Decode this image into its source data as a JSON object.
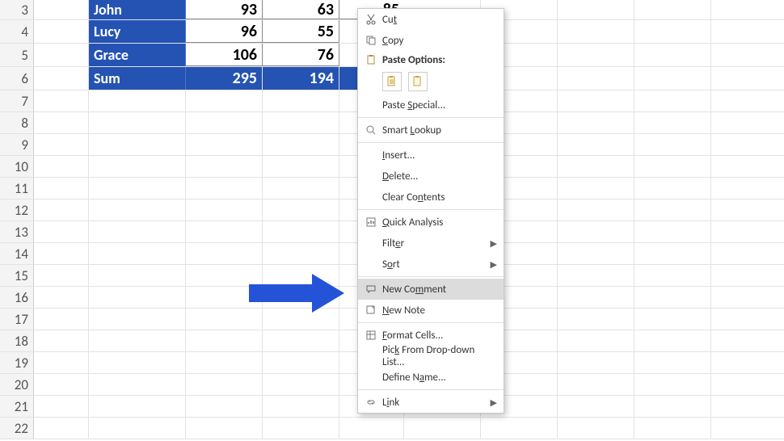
{
  "rows": [
    "3",
    "4",
    "5",
    "6",
    "7",
    "8",
    "9",
    "10",
    "11",
    "12",
    "13",
    "14",
    "15",
    "16",
    "17",
    "18",
    "19",
    "20",
    "21",
    "22"
  ],
  "table": {
    "r3": {
      "name": "John",
      "a": "93",
      "b": "63",
      "c": "85"
    },
    "r4": {
      "name": "Lucy",
      "a": "96",
      "b": "55"
    },
    "r5": {
      "name": "Grace",
      "a": "106",
      "b": "76"
    },
    "r6": {
      "name": "Sum",
      "a": "295",
      "b": "194"
    }
  },
  "menu": {
    "cut": "Cut",
    "copy": "Copy",
    "pasteOptions": "Paste Options:",
    "pasteSpecial": "Paste Special...",
    "smartLookup": "Smart Lookup",
    "insert": "Insert...",
    "delete": "Delete...",
    "clearContents": "Clear Contents",
    "quickAnalysis": "Quick Analysis",
    "filter": "Filter",
    "sort": "Sort",
    "newComment": "New Comment",
    "newNote": "New Note",
    "formatCells": "Format Cells...",
    "pickFromList": "Pick From Drop-down List...",
    "defineName": "Define Name...",
    "link": "Link"
  }
}
